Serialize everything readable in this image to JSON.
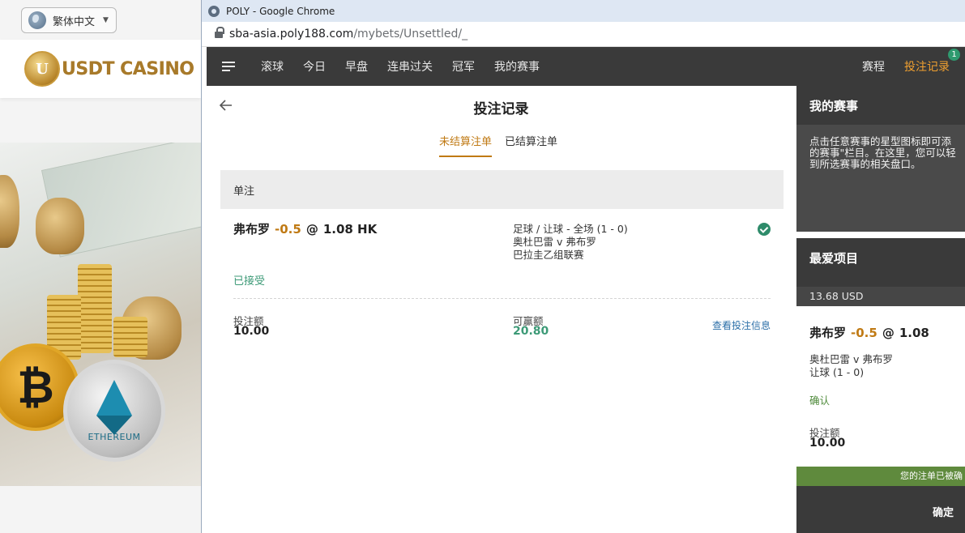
{
  "background_site": {
    "language": "繁体中文",
    "logo_text": "USDT CASINO",
    "logo_mark": "U",
    "bitcoin_symbol": "₿",
    "ethereum_label": "ETHEREUM"
  },
  "browser": {
    "window_title": "POLY - Google Chrome",
    "url_host": "sba-asia.poly188.com",
    "url_path": "/mybets/Unsettled/_"
  },
  "nav": {
    "items": [
      "滚球",
      "今日",
      "早盘",
      "连串过关",
      "冠军",
      "我的赛事"
    ],
    "schedule": "赛程",
    "bet_record": "投注记录",
    "bet_record_badge": "1"
  },
  "main": {
    "title": "投注记录",
    "tabs": {
      "unsettled": "未结算注单",
      "settled": "已结算注单"
    },
    "section_label": "单注",
    "bet": {
      "selection": "弗布罗",
      "handicap": "-0.5",
      "at": "@",
      "odds": "1.08 HK",
      "market": "足球 / 让球 - 全场 (1 - 0)",
      "match": "奥杜巴雷 v 弗布罗",
      "league": "巴拉圭乙组联赛",
      "status": "已接受",
      "stake_label": "投注额",
      "stake_value": "10.00",
      "win_label": "可赢额",
      "win_value": "20.80",
      "view_link": "查看投注信息"
    }
  },
  "sidebar": {
    "my_events_title": "我的赛事",
    "my_events_desc_lines": [
      "点击任意赛事的星型图标即可添",
      "的赛事\"栏目。在这里，您可以轻",
      "到所选赛事的相关盘口。"
    ],
    "favorites_title": "最爱项目",
    "balance": "13.68 USD",
    "slip": {
      "selection": "弗布罗",
      "handicap": "-0.5",
      "at": "@",
      "odds": "1.08",
      "match": "奥杜巴雷 v 弗布罗",
      "market": "让球 (1 - 0)",
      "confirm": "确认",
      "stake_label": "投注额",
      "stake_value": "10.00"
    },
    "notice": "您的注单已被确",
    "ok_button": "确定"
  }
}
